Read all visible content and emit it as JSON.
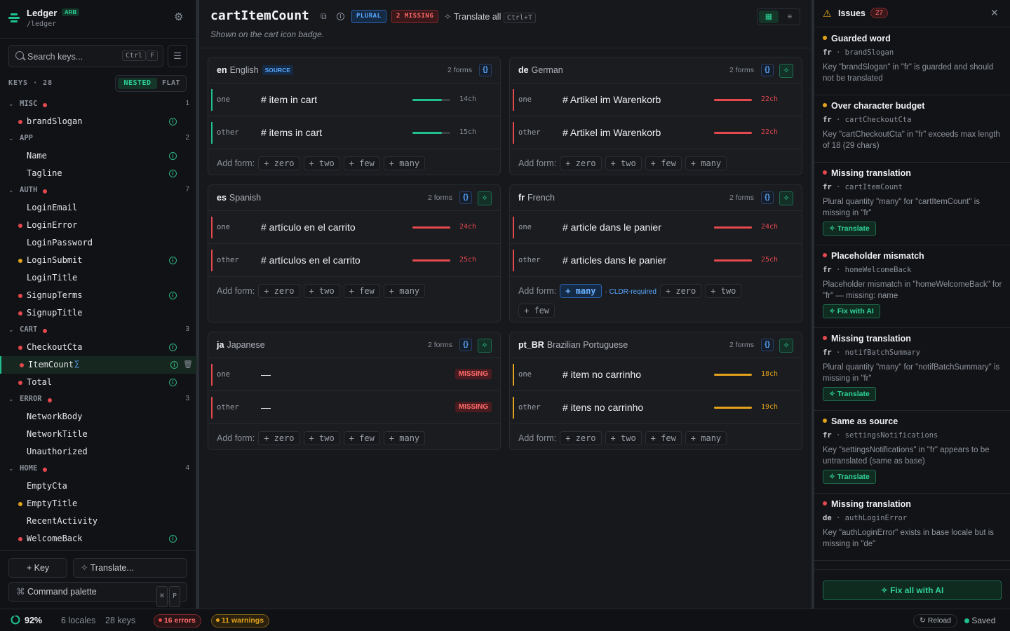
{
  "app": {
    "name": "Ledger",
    "badge": "ARB",
    "path": "/ledger"
  },
  "search": {
    "placeholder": "Search keys...",
    "kbd_ctrl": "Ctrl",
    "kbd_key": "F"
  },
  "keys": {
    "label": "KEYS · 28",
    "view_nested": "NESTED",
    "view_flat": "FLAT"
  },
  "groups": [
    {
      "name": "MISC",
      "count": "1",
      "error": true,
      "items": [
        {
          "name": "brandSlogan",
          "status": "red",
          "info": true
        }
      ]
    },
    {
      "name": "APP",
      "count": "2",
      "error": false,
      "items": [
        {
          "name": "Name",
          "status": "",
          "info": true
        },
        {
          "name": "Tagline",
          "status": "",
          "info": true
        }
      ]
    },
    {
      "name": "AUTH",
      "count": "7",
      "error": true,
      "items": [
        {
          "name": "LoginEmail",
          "status": "",
          "info": false
        },
        {
          "name": "LoginError",
          "status": "red",
          "info": false
        },
        {
          "name": "LoginPassword",
          "status": "",
          "info": false
        },
        {
          "name": "LoginSubmit",
          "status": "yel",
          "info": true
        },
        {
          "name": "LoginTitle",
          "status": "",
          "info": false
        },
        {
          "name": "SignupTerms",
          "status": "red",
          "info": true
        },
        {
          "name": "SignupTitle",
          "status": "red",
          "info": false
        }
      ]
    },
    {
      "name": "CART",
      "count": "3",
      "error": true,
      "items": [
        {
          "name": "CheckoutCta",
          "status": "red",
          "info": true
        },
        {
          "name": "ItemCount",
          "status": "red",
          "info": true,
          "selected": true
        },
        {
          "name": "Total",
          "status": "red",
          "info": true
        }
      ]
    },
    {
      "name": "ERROR",
      "count": "3",
      "error": true,
      "items": [
        {
          "name": "NetworkBody",
          "status": "",
          "info": false
        },
        {
          "name": "NetworkTitle",
          "status": "",
          "info": false
        },
        {
          "name": "Unauthorized",
          "status": "",
          "info": false
        }
      ]
    },
    {
      "name": "HOME",
      "count": "4",
      "error": true,
      "items": [
        {
          "name": "EmptyCta",
          "status": "",
          "info": false
        },
        {
          "name": "EmptyTitle",
          "status": "yel",
          "info": false
        },
        {
          "name": "RecentActivity",
          "status": "",
          "info": false
        },
        {
          "name": "WelcomeBack",
          "status": "red",
          "info": true
        }
      ]
    }
  ],
  "sidebar_footer": {
    "add_key": "+ Key",
    "translate": "Translate...",
    "command_palette": "Command palette",
    "kbd_cmd": "⌘",
    "kbd_p": "P"
  },
  "header": {
    "key": "cartItemCount",
    "tag_plural": "PLURAL",
    "tag_missing": "2 MISSING",
    "translate_all": "Translate all",
    "kbd": "Ctrl+T",
    "description": "Shown on the cart icon badge."
  },
  "locales": [
    {
      "code": "en",
      "name": "English",
      "source_label": "SOURCE",
      "forms_label": "2 forms",
      "rows": [
        {
          "cat": "one",
          "value": "# item in cart",
          "chars": "14ch",
          "level": 0.78,
          "state": "ok"
        },
        {
          "cat": "other",
          "value": "# items in cart",
          "chars": "15ch",
          "level": 0.78,
          "state": "ok"
        }
      ],
      "add_label": "Add form:",
      "add": [
        "+ zero",
        "+ two",
        "+ few",
        "+ many"
      ]
    },
    {
      "code": "de",
      "name": "German",
      "forms_label": "2 forms",
      "rows": [
        {
          "cat": "one",
          "value": "# Artikel im Warenkorb",
          "chars": "22ch",
          "level": 1,
          "state": "err"
        },
        {
          "cat": "other",
          "value": "# Artikel im Warenkorb",
          "chars": "22ch",
          "level": 1,
          "state": "err"
        }
      ],
      "add_label": "Add form:",
      "add": [
        "+ zero",
        "+ two",
        "+ few",
        "+ many"
      ]
    },
    {
      "code": "es",
      "name": "Spanish",
      "forms_label": "2 forms",
      "rows": [
        {
          "cat": "one",
          "value": "# artículo en el carrito",
          "chars": "24ch",
          "level": 1,
          "state": "err"
        },
        {
          "cat": "other",
          "value": "# artículos en el carrito",
          "chars": "25ch",
          "level": 1,
          "state": "err"
        }
      ],
      "add_label": "Add form:",
      "add": [
        "+ zero",
        "+ two",
        "+ few",
        "+ many"
      ]
    },
    {
      "code": "fr",
      "name": "French",
      "forms_label": "2 forms",
      "rows": [
        {
          "cat": "one",
          "value": "# article dans le panier",
          "chars": "24ch",
          "level": 1,
          "state": "err"
        },
        {
          "cat": "other",
          "value": "# articles dans le panier",
          "chars": "25ch",
          "level": 1,
          "state": "err"
        }
      ],
      "add_label": "Add form:",
      "required": "+ many",
      "required_note": "· CLDR-required",
      "add": [
        "+ zero",
        "+ two"
      ],
      "add2": [
        "+ few"
      ]
    },
    {
      "code": "ja",
      "name": "Japanese",
      "forms_label": "2 forms",
      "rows": [
        {
          "cat": "one",
          "value": "—",
          "missing": "MISSING",
          "state": "miss"
        },
        {
          "cat": "other",
          "value": "—",
          "missing": "MISSING",
          "state": "miss"
        }
      ],
      "add_label": "Add form:",
      "add": [
        "+ zero",
        "+ two",
        "+ few",
        "+ many"
      ]
    },
    {
      "code": "pt_BR",
      "name": "Brazilian Portuguese",
      "forms_label": "2 forms",
      "rows": [
        {
          "cat": "one",
          "value": "# item no carrinho",
          "chars": "18ch",
          "level": 1,
          "state": "warn"
        },
        {
          "cat": "other",
          "value": "# itens no carrinho",
          "chars": "19ch",
          "level": 1,
          "state": "warn"
        }
      ],
      "add_label": "Add form:",
      "add": [
        "+ zero",
        "+ two",
        "+ few",
        "+ many"
      ]
    }
  ],
  "issues": {
    "title": "Issues",
    "count": "27",
    "fix_all": "Fix all with AI",
    "list": [
      {
        "title": "Guarded word",
        "sev": "yel",
        "locale": "fr",
        "key": "brandSlogan",
        "desc": "Key \"brandSlogan\" in \"fr\" is guarded and should not be translated",
        "action": ""
      },
      {
        "title": "Over character budget",
        "sev": "yel",
        "locale": "fr",
        "key": "cartCheckoutCta",
        "desc": "Key \"cartCheckoutCta\" in \"fr\" exceeds max length of 18 (29 chars)",
        "action": ""
      },
      {
        "title": "Missing translation",
        "sev": "red",
        "locale": "fr",
        "key": "cartItemCount",
        "desc": "Plural quantity \"many\" for \"cartItemCount\" is missing in \"fr\"",
        "action": "Translate"
      },
      {
        "title": "Placeholder mismatch",
        "sev": "red",
        "locale": "fr",
        "key": "homeWelcomeBack",
        "desc": "Placeholder mismatch in \"homeWelcomeBack\" for \"fr\" — missing: name",
        "action": "Fix with AI"
      },
      {
        "title": "Missing translation",
        "sev": "red",
        "locale": "fr",
        "key": "notifBatchSummary",
        "desc": "Plural quantity \"many\" for \"notifBatchSummary\" is missing in \"fr\"",
        "action": "Translate"
      },
      {
        "title": "Same as source",
        "sev": "yel",
        "locale": "fr",
        "key": "settingsNotifications",
        "desc": "Key \"settingsNotifications\" in \"fr\" appears to be untranslated (same as base)",
        "action": "Translate"
      },
      {
        "title": "Missing translation",
        "sev": "red",
        "locale": "de",
        "key": "authLoginError",
        "desc": "Key \"authLoginError\" exists in base locale but is missing in \"de\"",
        "action": ""
      }
    ]
  },
  "status": {
    "coverage": "92%",
    "coverage_value": 0.92,
    "locales": "6 locales",
    "keys": "28 keys",
    "errors": "16 errors",
    "warnings": "11 warnings",
    "reload": "Reload",
    "saved": "Saved"
  },
  "colors": {
    "accent": "#1fbf8f",
    "error": "#e5484d",
    "warning": "#e2a21b",
    "info": "#5aa8ff"
  }
}
